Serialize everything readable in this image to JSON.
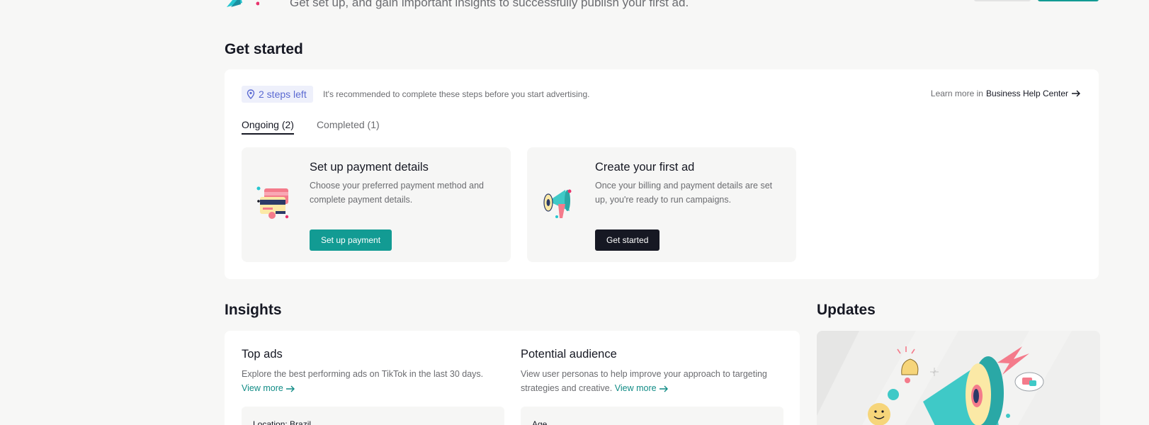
{
  "banner": {
    "subtitle": "Get set up, and gain important insights to successfully publish your first ad."
  },
  "get_started": {
    "title": "Get started",
    "steps_badge": "2 steps left",
    "steps_hint": "It's recommended to complete these steps before you start advertising.",
    "learn_more_prefix": "Learn more in",
    "learn_more_link": "Business Help Center",
    "tabs": [
      {
        "label": "Ongoing (2)",
        "active": true
      },
      {
        "label": "Completed (1)",
        "active": false
      }
    ],
    "tasks": [
      {
        "title": "Set up payment details",
        "description": "Choose your preferred payment method and complete payment details.",
        "button": "Set up payment",
        "icon": "payment-card-icon"
      },
      {
        "title": "Create your first ad",
        "description": "Once your billing and payment details are set up, you're ready to run campaigns.",
        "button": "Get started",
        "icon": "megaphone-icon"
      }
    ]
  },
  "insights": {
    "title": "Insights",
    "top_ads": {
      "title": "Top ads",
      "description": "Explore the best performing ads on TikTok in the last 30 days.",
      "view_more": "View more",
      "box_label": "Location: Brazil"
    },
    "potential_audience": {
      "title": "Potential audience",
      "description": "View user personas to help improve your approach to targeting strategies and creative.",
      "view_more": "View more",
      "box_label": "Age"
    }
  },
  "updates": {
    "title": "Updates",
    "illustration": "megaphone-illustration"
  },
  "colors": {
    "accent_teal": "#129b93",
    "link_teal": "#118c86",
    "badge_purple": "#5b6ad2",
    "dark_button": "#161823",
    "page_bg": "#f7f7f6"
  }
}
